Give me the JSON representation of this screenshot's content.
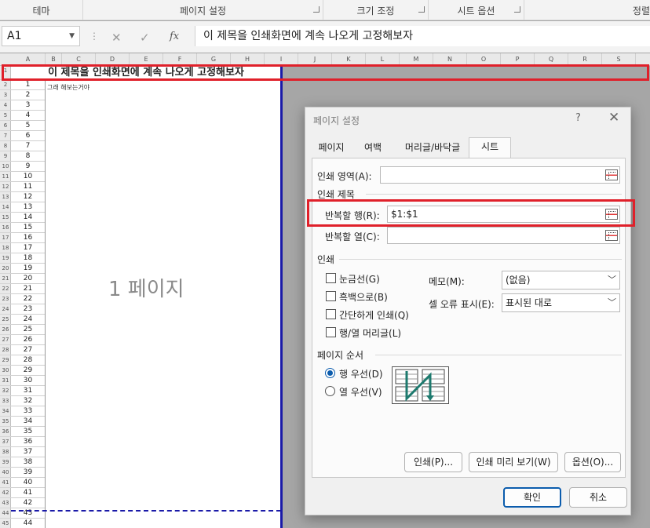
{
  "ribbon": {
    "groups": [
      "테마",
      "페이지 설정",
      "크기 조정",
      "시트 옵션",
      "정렬"
    ]
  },
  "formula_bar": {
    "name_box": "A1",
    "fx_label": "fx",
    "content": "이 제목을 인쇄화면에 계속 나오게 고정해보자"
  },
  "sheet": {
    "column_headers": [
      "A",
      "B",
      "C",
      "D",
      "E",
      "F",
      "G",
      "H",
      "I",
      "J",
      "K",
      "L",
      "M",
      "N",
      "O",
      "P",
      "Q",
      "R",
      "S"
    ],
    "row_numbers": [
      "1",
      "2",
      "3",
      "4",
      "5",
      "6",
      "7",
      "8",
      "9",
      "10",
      "11",
      "12",
      "13",
      "14",
      "15",
      "16",
      "17",
      "18",
      "19",
      "20",
      "21",
      "22",
      "23",
      "24",
      "25",
      "26",
      "27",
      "28",
      "29",
      "30",
      "31",
      "32",
      "33",
      "34",
      "35",
      "36",
      "37",
      "38",
      "39",
      "40",
      "41",
      "42",
      "43",
      "44",
      "45"
    ],
    "a_values": [
      "1",
      "2",
      "3",
      "4",
      "5",
      "6",
      "7",
      "8",
      "9",
      "10",
      "11",
      "12",
      "13",
      "14",
      "15",
      "16",
      "17",
      "18",
      "19",
      "20",
      "21",
      "22",
      "23",
      "24",
      "25",
      "26",
      "27",
      "28",
      "29",
      "30",
      "31",
      "32",
      "33",
      "34",
      "35",
      "36",
      "37",
      "38",
      "39",
      "40",
      "41",
      "42",
      "43",
      "44"
    ],
    "title_cell": "이 제목을 인쇄화면에 계속 나오게 고정해보자",
    "b2_text": "그래 해보는거야",
    "page_watermark": "1 페이지"
  },
  "dialog": {
    "title": "페이지 설정",
    "help": "?",
    "close": "✕",
    "tabs": [
      "페이지",
      "여백",
      "머리글/바닥글",
      "시트"
    ],
    "active_tab": "시트",
    "print_area_label": "인쇄 영역(A):",
    "print_area_value": "",
    "print_titles_section": "인쇄 제목",
    "repeat_rows_label": "반복할 행(R):",
    "repeat_rows_value": "$1:$1",
    "repeat_cols_label": "반복할 열(C):",
    "repeat_cols_value": "",
    "print_section": "인쇄",
    "checkboxes": [
      "눈금선(G)",
      "흑백으로(B)",
      "간단하게 인쇄(Q)",
      "행/열 머리글(L)"
    ],
    "comments_label": "메모(M):",
    "comments_value": "(없음)",
    "cell_errors_label": "셀 오류 표시(E):",
    "cell_errors_value": "표시된 대로",
    "page_order_section": "페이지 순서",
    "radio_down_then_over": "행 우선(D)",
    "radio_over_then_down": "열 우선(V)",
    "btn_print": "인쇄(P)...",
    "btn_preview": "인쇄 미리 보기(W)",
    "btn_options": "옵션(O)...",
    "btn_ok": "확인",
    "btn_cancel": "취소"
  },
  "colors": {
    "highlight": "#e0202a",
    "page_break": "#1a1aa8",
    "accent": "#0b5cad"
  }
}
